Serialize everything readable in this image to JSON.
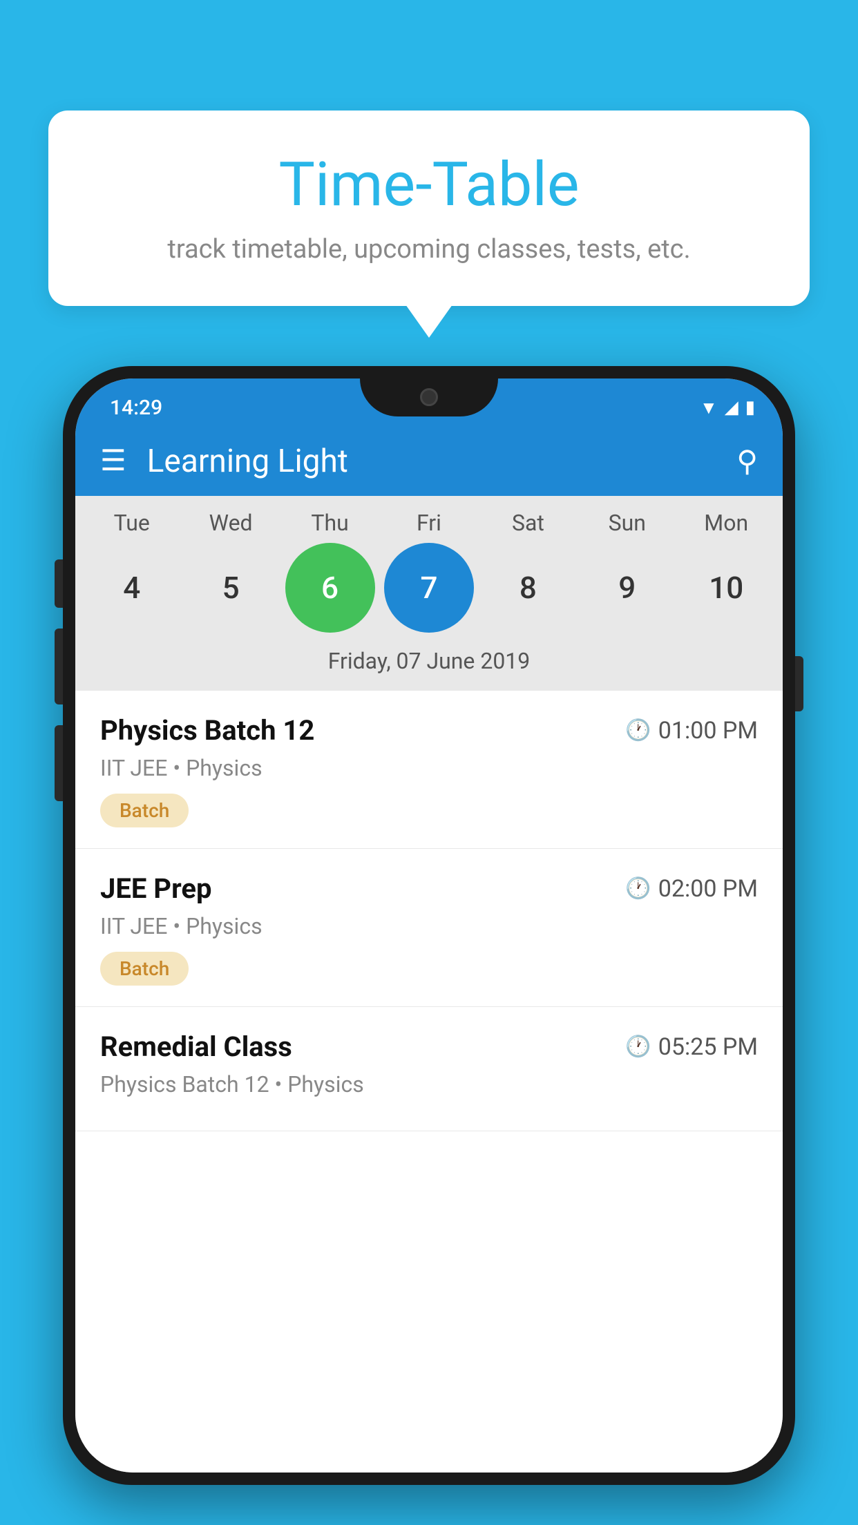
{
  "background_color": "#29b6e8",
  "bubble": {
    "title": "Time-Table",
    "subtitle": "track timetable, upcoming classes, tests, etc."
  },
  "status_bar": {
    "time": "14:29"
  },
  "app_bar": {
    "title": "Learning Light"
  },
  "calendar": {
    "days": [
      "Tue",
      "Wed",
      "Thu",
      "Fri",
      "Sat",
      "Sun",
      "Mon"
    ],
    "numbers": [
      "4",
      "5",
      "6",
      "7",
      "8",
      "9",
      "10"
    ],
    "today_index": 2,
    "selected_index": 3,
    "date_label": "Friday, 07 June 2019"
  },
  "schedule": {
    "items": [
      {
        "title": "Physics Batch 12",
        "time": "01:00 PM",
        "subtitle": "IIT JEE • Physics",
        "badge": "Batch"
      },
      {
        "title": "JEE Prep",
        "time": "02:00 PM",
        "subtitle": "IIT JEE • Physics",
        "badge": "Batch"
      },
      {
        "title": "Remedial Class",
        "time": "05:25 PM",
        "subtitle": "Physics Batch 12 • Physics",
        "badge": null
      }
    ]
  },
  "icons": {
    "hamburger": "☰",
    "search": "🔍",
    "clock": "🕐"
  }
}
